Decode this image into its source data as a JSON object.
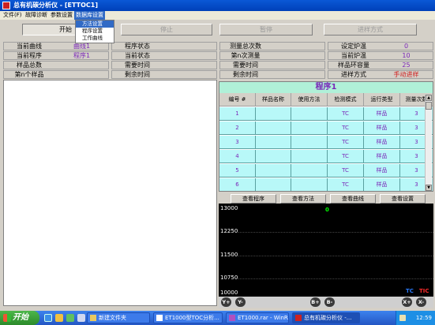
{
  "window": {
    "title": "总有机碳分析仪 - [ETTOC1]"
  },
  "menu": {
    "items": [
      "文件(F)",
      "故障诊断",
      "参数设置",
      "数据库设置"
    ]
  },
  "dropdown": {
    "items": [
      "方法设置",
      "程序设置",
      "工作曲线"
    ]
  },
  "toolbar": {
    "start": "开始",
    "stop": "停止",
    "pause": "暂停",
    "feed": "进样方式"
  },
  "info": {
    "col1": [
      {
        "label": "当前曲线",
        "value": "曲线1"
      },
      {
        "label": "当前程序",
        "value": "程序1"
      },
      {
        "label": "样品总数",
        "value": ""
      },
      {
        "label": "第n个样品",
        "value": ""
      }
    ],
    "col2": [
      {
        "label": "程序状态",
        "value": ""
      },
      {
        "label": "当前状态",
        "value": ""
      },
      {
        "label": "需要时间",
        "value": ""
      },
      {
        "label": "剩余时间",
        "value": ""
      }
    ],
    "col3": [
      {
        "label": "测量总次数",
        "value": ""
      },
      {
        "label": "第n次测量",
        "value": ""
      },
      {
        "label": "需要时间",
        "value": ""
      },
      {
        "label": "剩余时间",
        "value": ""
      }
    ],
    "col4": [
      {
        "label": "设定炉温",
        "value": "0"
      },
      {
        "label": "当前炉温",
        "value": "10"
      },
      {
        "label": "样品环容量",
        "value": "25"
      },
      {
        "label": "进样方式",
        "value": "手动进样"
      }
    ]
  },
  "program": {
    "title": "程序1",
    "headers": [
      "编号 #",
      "样品名称",
      "使用方法",
      "检测模式",
      "运行类型",
      "测量次数"
    ],
    "rows": [
      [
        "1",
        "",
        "",
        "TC",
        "样品",
        "3"
      ],
      [
        "2",
        "",
        "",
        "TC",
        "样品",
        "3"
      ],
      [
        "3",
        "",
        "",
        "TC",
        "样品",
        "3"
      ],
      [
        "4",
        "",
        "",
        "TC",
        "样品",
        "3"
      ],
      [
        "5",
        "",
        "",
        "TC",
        "样品",
        "3"
      ],
      [
        "6",
        "",
        "",
        "TC",
        "样品",
        "3"
      ]
    ]
  },
  "viewbuttons": [
    "查看程序",
    "查看方法",
    "查看曲线",
    "查看设置"
  ],
  "plot": {
    "yticks": [
      "13000",
      "12250",
      "11500",
      "10750",
      "10000"
    ],
    "marker": "0",
    "legend": [
      "TC",
      "TIC"
    ],
    "colors": {
      "tc": "#2a7bff",
      "tic": "#ff2a2a",
      "marker": "#00ff00"
    }
  },
  "controls": [
    "Y+",
    "Y-",
    "B+",
    "B-",
    "X+",
    "X-"
  ],
  "taskbar": {
    "start": "开始",
    "tasks": [
      "新建文件夹",
      "ET1000型TOC分析...",
      "ET1000.rar - WinRAR",
      "总有机碳分析仪 -..."
    ],
    "clock": "12:59"
  }
}
